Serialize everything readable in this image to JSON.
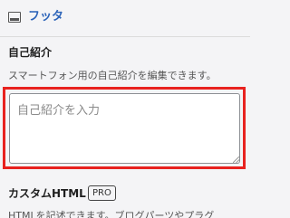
{
  "section": {
    "title": "フッタ",
    "icon": "footer-layout-icon"
  },
  "self_intro": {
    "label": "自己紹介",
    "description": "スマートフォン用の自己紹介を編集できます。",
    "placeholder": "自己紹介を入力",
    "value": "",
    "highlight_color": "#e8221f"
  },
  "custom_html": {
    "label": "カスタムHTML",
    "badge": "PRO",
    "description": "HTMLを記述できます。ブログパーツやプラグ"
  },
  "colors": {
    "accent": "#2a62b8",
    "highlight": "#e8221f",
    "background": "#f4f4f6"
  }
}
